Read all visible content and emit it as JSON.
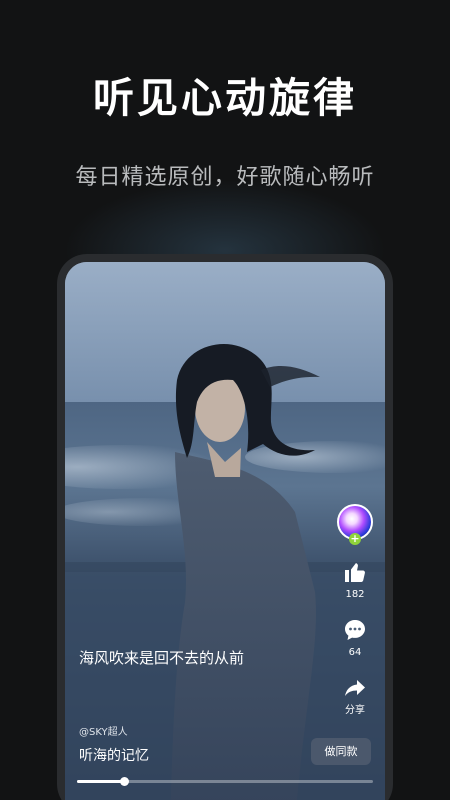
{
  "header": {
    "title": "听见心动旋律",
    "subtitle": "每日精选原创，好歌随心畅听"
  },
  "video": {
    "caption": "海风吹来是回不去的从前",
    "author": "@SKY超人",
    "song_title": "听海的记忆",
    "make_same_label": "做同款",
    "progress": 0.16
  },
  "actions": {
    "follow_symbol": "+",
    "like_count": "182",
    "comment_count": "64",
    "share_label": "分享"
  },
  "icons": [
    "avatar",
    "follow-plus-icon",
    "thumbs-up-icon",
    "comment-icon",
    "share-icon"
  ],
  "colors": {
    "background": "#121314",
    "follow_badge": "#8fd33a",
    "button_bg": "#505c6e"
  }
}
